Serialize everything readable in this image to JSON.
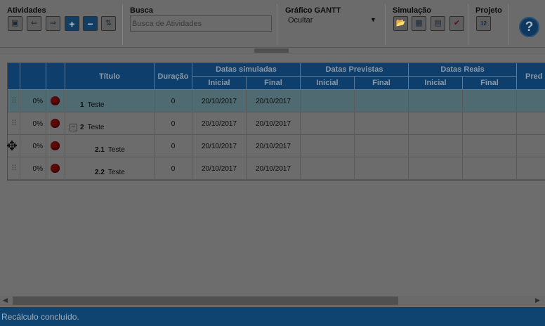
{
  "toolbar": {
    "atividades": {
      "title": "Atividades",
      "buttons": [
        {
          "name": "save-button",
          "glyph": "▣"
        },
        {
          "name": "indent-left-button",
          "glyph": "⇐"
        },
        {
          "name": "indent-right-button",
          "glyph": "⇒"
        },
        {
          "name": "add-activity-button",
          "glyph": "+"
        },
        {
          "name": "remove-activity-button",
          "glyph": "−"
        },
        {
          "name": "move-activity-button",
          "glyph": "⇅"
        }
      ]
    },
    "busca": {
      "title": "Busca",
      "placeholder": "Busca de Atividades"
    },
    "gantt": {
      "title": "Gráfico GANTT",
      "value": "Ocultar",
      "arrow": "▼"
    },
    "simulacao": {
      "title": "Simulação",
      "buttons": [
        {
          "name": "open-simulation-button",
          "glyph": "📂"
        },
        {
          "name": "simulation-table-button",
          "glyph": "▦"
        },
        {
          "name": "simulation-doc-button",
          "glyph": "▤"
        },
        {
          "name": "simulation-approve-button",
          "glyph": "✔"
        }
      ]
    },
    "projeto": {
      "title": "Projeto",
      "calendar_day": "12"
    },
    "help_glyph": "?"
  },
  "grid": {
    "headers": {
      "titulo": "Título",
      "duracao": "Duração",
      "simuladas": "Datas simuladas",
      "previstas": "Datas Previstas",
      "reais": "Datas Reais",
      "pred": "Pred",
      "inicial": "Inicial",
      "final": "Final"
    },
    "rows": [
      {
        "percent": "0%",
        "num": "1",
        "title": "Teste",
        "duration": "0",
        "sim_start": "20/10/2017",
        "sim_end": "20/10/2017",
        "selected": true,
        "level": 0,
        "collapsible": false
      },
      {
        "percent": "0%",
        "num": "2",
        "title": "Teste",
        "duration": "0",
        "sim_start": "20/10/2017",
        "sim_end": "20/10/2017",
        "selected": false,
        "level": 0,
        "collapsible": true
      },
      {
        "percent": "0%",
        "num": "2.1",
        "title": "Teste",
        "duration": "0",
        "sim_start": "20/10/2017",
        "sim_end": "20/10/2017",
        "selected": false,
        "level": 1,
        "collapsible": false
      },
      {
        "percent": "0%",
        "num": "2.2",
        "title": "Teste",
        "duration": "0",
        "sim_start": "20/10/2017",
        "sim_end": "20/10/2017",
        "selected": false,
        "level": 1,
        "collapsible": false
      }
    ]
  },
  "status": {
    "text": "Recálculo concluído."
  },
  "colors": {
    "header_bg": "#0e3f6c",
    "selected_row": "#4f6a71",
    "status_bg": "#0f4470",
    "progress_dot": "#5e0a0a"
  }
}
